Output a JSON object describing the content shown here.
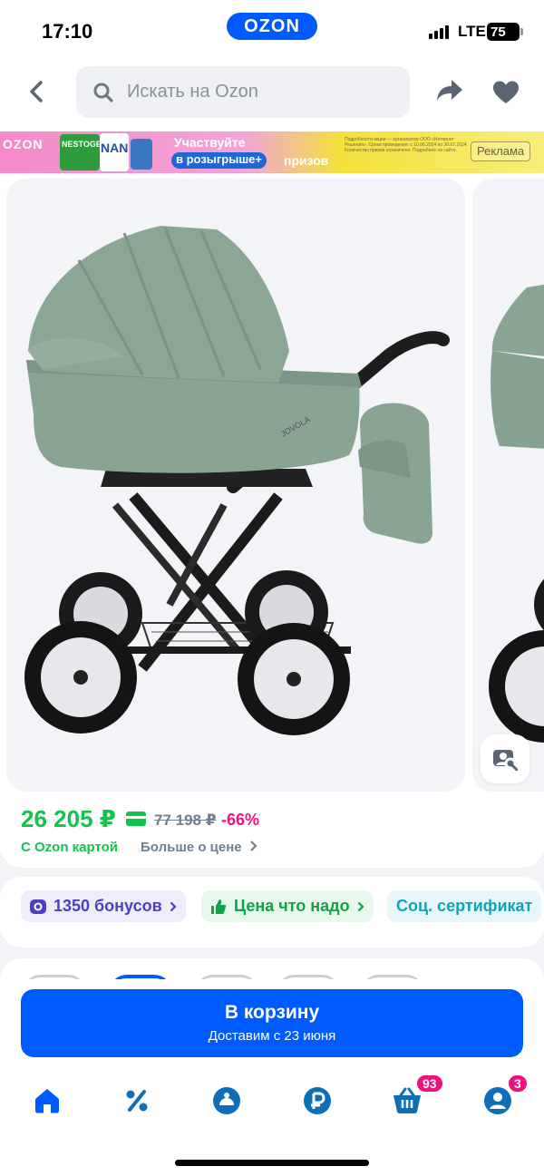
{
  "status_bar": {
    "time": "17:10",
    "brand": "OZON",
    "network": "LTE",
    "battery": "75"
  },
  "header": {
    "search_placeholder": "Искать на Ozon"
  },
  "banner": {
    "logo": "OZON",
    "pack1": "NESTOGEN",
    "pack2": "NAN",
    "line1": "Участвуйте",
    "line2": "в розыгрыше+",
    "line3": "призов",
    "fine_print": "Подробности акции — организатор ООО «Интернет Решения». Сроки проведения: с 10.06.2024 по 30.07.2024. Количество призов ограничено. Подробнее на сайте.",
    "ad_label": "Реклама"
  },
  "product": {
    "brand_on_stroller": "JOVOLA"
  },
  "price": {
    "current": "26 205 ₽",
    "old": "77 198 ₽",
    "discount": "-66%",
    "card_note": "С Ozon картой",
    "more_link": "Больше о цене"
  },
  "chips": [
    {
      "label": "1350 бонусов"
    },
    {
      "label": "Цена что надо"
    },
    {
      "label": "Соц. сертификат"
    }
  ],
  "cart": {
    "label": "В корзину",
    "delivery": "Доставим с 23 июня"
  },
  "tabbar": {
    "items": [
      "home",
      "sale",
      "fresh",
      "finance",
      "cart",
      "profile"
    ],
    "cart_badge": "93",
    "profile_badge": "3",
    "active_color": "#005bff",
    "inactive_color": "#0e6fb8"
  },
  "colors": {
    "brand_blue": "#005bff",
    "price_green": "#10c44c",
    "discount_pink": "#f1117e",
    "stroller_green": "#86a393"
  }
}
